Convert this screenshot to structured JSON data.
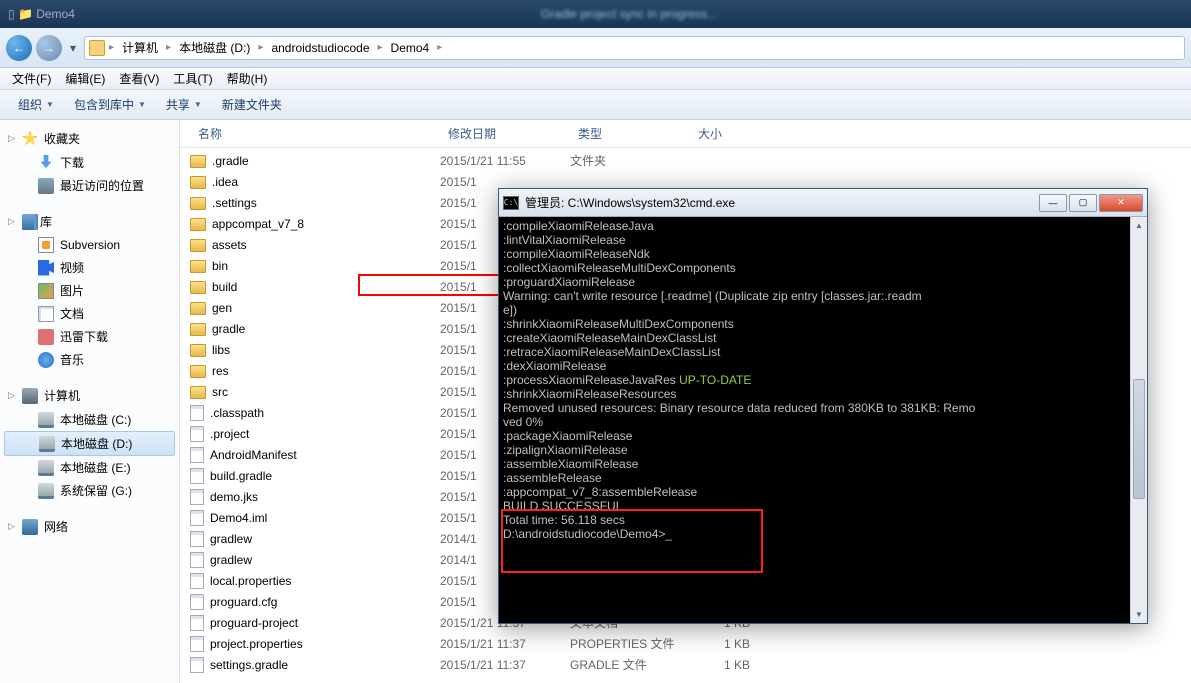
{
  "titlebar": {
    "left_hint": "▯ 📁 Demo4",
    "center_blur": "Gradle project sync in progress..."
  },
  "address": {
    "segments": [
      "计算机",
      "本地磁盘 (D:)",
      "androidstudiocode",
      "Demo4"
    ]
  },
  "menu": {
    "items": [
      "文件(F)",
      "编辑(E)",
      "查看(V)",
      "工具(T)",
      "帮助(H)"
    ]
  },
  "toolbar": {
    "items": [
      "组织",
      "包含到库中",
      "共享",
      "新建文件夹"
    ]
  },
  "sidebar": {
    "groups": [
      {
        "head": "收藏夹",
        "icon": "star",
        "items": [
          {
            "label": "下载",
            "icon": "dl"
          },
          {
            "label": "最近访问的位置",
            "icon": "recent"
          }
        ]
      },
      {
        "head": "库",
        "icon": "lib",
        "items": [
          {
            "label": "Subversion",
            "icon": "svn"
          },
          {
            "label": "视频",
            "icon": "vid"
          },
          {
            "label": "图片",
            "icon": "img"
          },
          {
            "label": "文档",
            "icon": "doc"
          },
          {
            "label": "迅雷下载",
            "icon": "xl"
          },
          {
            "label": "音乐",
            "icon": "mus"
          }
        ]
      },
      {
        "head": "计算机",
        "icon": "comp",
        "items": [
          {
            "label": "本地磁盘 (C:)",
            "icon": "drive"
          },
          {
            "label": "本地磁盘 (D:)",
            "icon": "drive",
            "selected": true
          },
          {
            "label": "本地磁盘 (E:)",
            "icon": "drive"
          },
          {
            "label": "系统保留 (G:)",
            "icon": "drive"
          }
        ]
      },
      {
        "head": "网络",
        "icon": "net",
        "items": []
      }
    ]
  },
  "columns": {
    "name": "名称",
    "date": "修改日期",
    "type": "类型",
    "size": "大小"
  },
  "files": [
    {
      "name": ".gradle",
      "date": "2015/1/21 11:55",
      "type": "文件夹",
      "size": "",
      "icon": "folder"
    },
    {
      "name": ".idea",
      "date": "2015/1",
      "type": "",
      "size": "",
      "icon": "folder"
    },
    {
      "name": ".settings",
      "date": "2015/1",
      "type": "",
      "size": "",
      "icon": "folder"
    },
    {
      "name": "appcompat_v7_8",
      "date": "2015/1",
      "type": "",
      "size": "",
      "icon": "folder"
    },
    {
      "name": "assets",
      "date": "2015/1",
      "type": "",
      "size": "",
      "icon": "folder"
    },
    {
      "name": "bin",
      "date": "2015/1",
      "type": "",
      "size": "",
      "icon": "folder"
    },
    {
      "name": "build",
      "date": "2015/1",
      "type": "",
      "size": "",
      "icon": "folder",
      "hl": true
    },
    {
      "name": "gen",
      "date": "2015/1",
      "type": "",
      "size": "",
      "icon": "folder"
    },
    {
      "name": "gradle",
      "date": "2015/1",
      "type": "",
      "size": "",
      "icon": "folder"
    },
    {
      "name": "libs",
      "date": "2015/1",
      "type": "",
      "size": "",
      "icon": "folder"
    },
    {
      "name": "res",
      "date": "2015/1",
      "type": "",
      "size": "",
      "icon": "folder"
    },
    {
      "name": "src",
      "date": "2015/1",
      "type": "",
      "size": "",
      "icon": "folder"
    },
    {
      "name": ".classpath",
      "date": "2015/1",
      "type": "",
      "size": "",
      "icon": "file"
    },
    {
      "name": ".project",
      "date": "2015/1",
      "type": "",
      "size": "",
      "icon": "file"
    },
    {
      "name": "AndroidManifest",
      "date": "2015/1",
      "type": "",
      "size": "",
      "icon": "file"
    },
    {
      "name": "build.gradle",
      "date": "2015/1",
      "type": "",
      "size": "",
      "icon": "file"
    },
    {
      "name": "demo.jks",
      "date": "2015/1",
      "type": "",
      "size": "",
      "icon": "file"
    },
    {
      "name": "Demo4.iml",
      "date": "2015/1",
      "type": "",
      "size": "",
      "icon": "file"
    },
    {
      "name": "gradlew",
      "date": "2014/1",
      "type": "",
      "size": "",
      "icon": "file"
    },
    {
      "name": "gradlew",
      "date": "2014/1",
      "type": "",
      "size": "",
      "icon": "file"
    },
    {
      "name": "local.properties",
      "date": "2015/1",
      "type": "",
      "size": "",
      "icon": "file"
    },
    {
      "name": "proguard.cfg",
      "date": "2015/1",
      "type": "",
      "size": "",
      "icon": "file"
    },
    {
      "name": "proguard-project",
      "date": "2015/1/21 11:37",
      "type": "文本文档",
      "size": "1 KB",
      "icon": "file"
    },
    {
      "name": "project.properties",
      "date": "2015/1/21 11:37",
      "type": "PROPERTIES 文件",
      "size": "1 KB",
      "icon": "file"
    },
    {
      "name": "settings.gradle",
      "date": "2015/1/21 11:37",
      "type": "GRADLE 文件",
      "size": "1 KB",
      "icon": "file"
    }
  ],
  "cmd": {
    "title": "管理员: C:\\Windows\\system32\\cmd.exe",
    "lines": [
      {
        "t": ":compileXiaomiReleaseJava"
      },
      {
        "t": ":lintVitalXiaomiRelease"
      },
      {
        "t": ":compileXiaomiReleaseNdk"
      },
      {
        "t": ":collectXiaomiReleaseMultiDexComponents"
      },
      {
        "t": ":proguardXiaomiRelease"
      },
      {
        "t": "Warning: can't write resource [.readme] (Duplicate zip entry [classes.jar:.readm"
      },
      {
        "t": "e])"
      },
      {
        "t": ":shrinkXiaomiReleaseMultiDexComponents"
      },
      {
        "t": ":createXiaomiReleaseMainDexClassList"
      },
      {
        "t": ":retraceXiaomiReleaseMainDexClassList"
      },
      {
        "t": ":dexXiaomiRelease"
      },
      {
        "t": ":processXiaomiReleaseJavaRes ",
        "ok": "UP-TO-DATE"
      },
      {
        "t": ":shrinkXiaomiReleaseResources"
      },
      {
        "t": "Removed unused resources: Binary resource data reduced from 380KB to 381KB: Remo"
      },
      {
        "t": "ved 0%"
      },
      {
        "t": ":packageXiaomiRelease"
      },
      {
        "t": ":zipalignXiaomiRelease"
      },
      {
        "t": ":assembleXiaomiRelease"
      },
      {
        "t": ":assembleRelease"
      },
      {
        "t": ":appcompat_v7_8:assembleRelease"
      },
      {
        "t": ""
      },
      {
        "t": "BUILD SUCCESSFUL"
      },
      {
        "t": ""
      },
      {
        "t": "Total time: 56.118 secs"
      },
      {
        "t": "D:\\androidstudiocode\\Demo4>_"
      }
    ],
    "winbtns": {
      "min": "—",
      "max": "▢",
      "close": "✕"
    }
  }
}
